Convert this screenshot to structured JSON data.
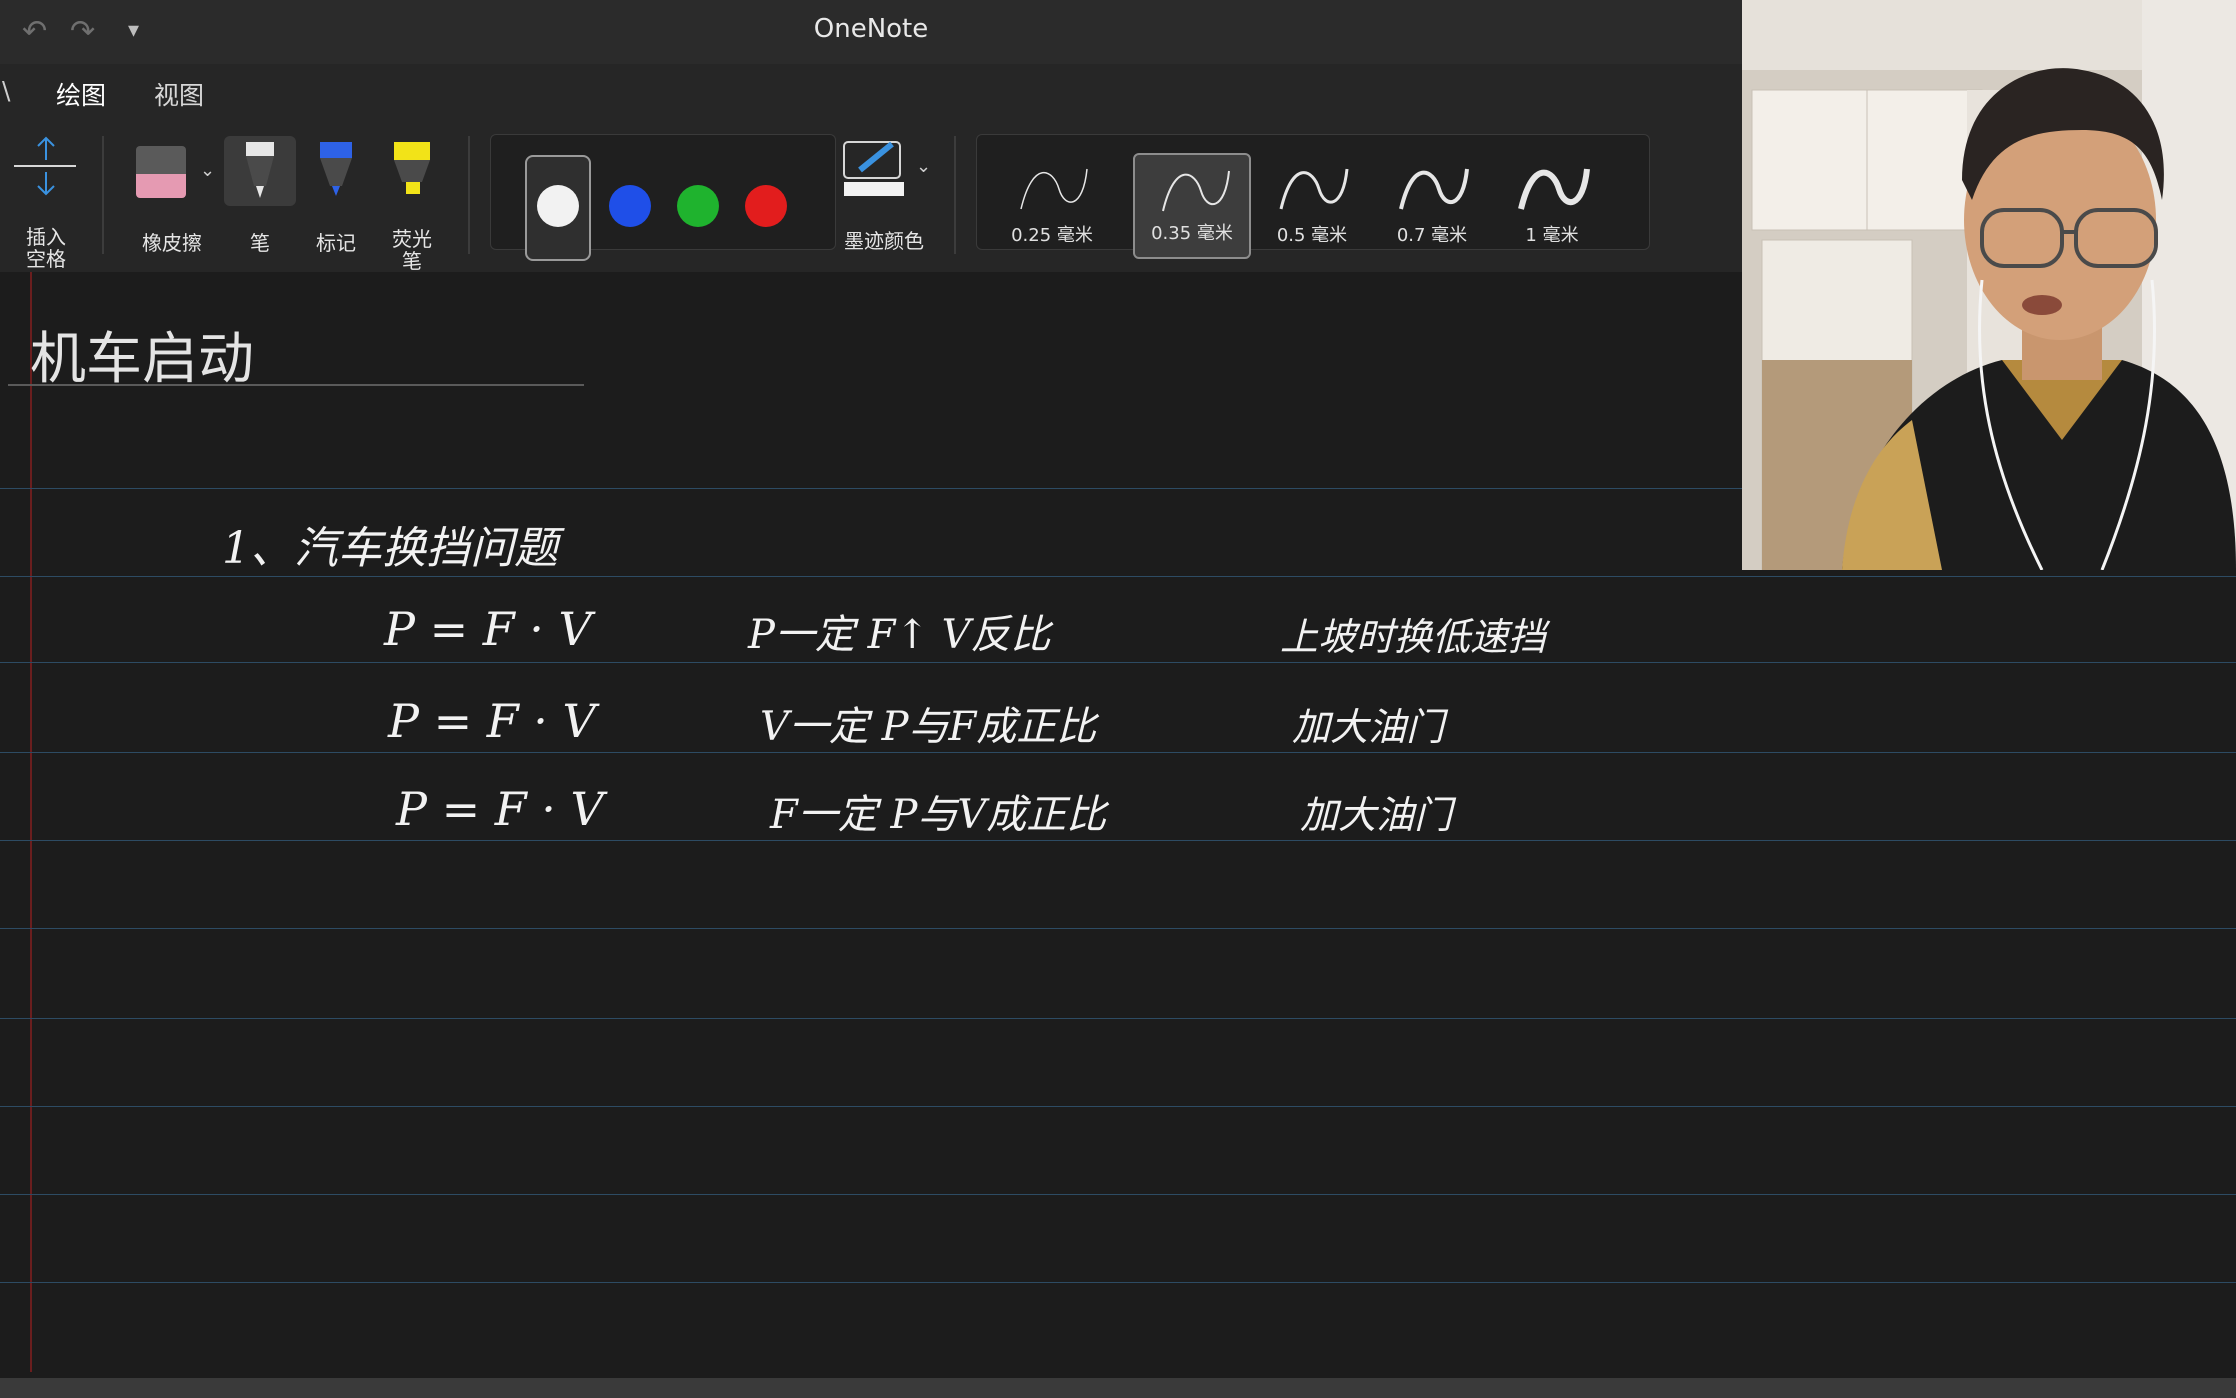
{
  "window": {
    "title": "OneNote"
  },
  "quick_access": {
    "undo_icon": "undo-icon",
    "redo_icon": "redo-icon",
    "customize_icon": "customize-icon"
  },
  "tabs": [
    {
      "label": "绘图",
      "active": true
    },
    {
      "label": "视图",
      "active": false
    }
  ],
  "toolbar": {
    "insert_space_label": "插入\n空格",
    "eraser_label": "橡皮擦",
    "pen_label": "笔",
    "marker_label": "标记",
    "highlighter_label": "荧光\n笔",
    "ink_color_label": "墨迹颜色",
    "colors": [
      "#f2f2f2",
      "#1f4fe8",
      "#1fb32e",
      "#e21d1d"
    ],
    "selected_color_index": 0,
    "thickness": [
      {
        "label": "0.25 毫米",
        "selected": false
      },
      {
        "label": "0.35 毫米",
        "selected": true
      },
      {
        "label": "0.5 毫米",
        "selected": false
      },
      {
        "label": "0.7 毫米",
        "selected": false
      },
      {
        "label": "1 毫米",
        "selected": false
      }
    ]
  },
  "page": {
    "title": "机车启动",
    "ink": {
      "heading": "1、汽车换挡问题",
      "rows": [
        {
          "formula": "P = F · V",
          "condition": "P一定 F↑ V反比",
          "note": "上坡时换低速挡"
        },
        {
          "formula": "P = F · V",
          "condition": "V一定 P与F成正比",
          "note": "加大油门"
        },
        {
          "formula": "P = F · V",
          "condition": "F一定 P与V成正比",
          "note": "加大油门"
        }
      ]
    }
  },
  "webcam": {
    "description_icon": "webcam-feed"
  }
}
